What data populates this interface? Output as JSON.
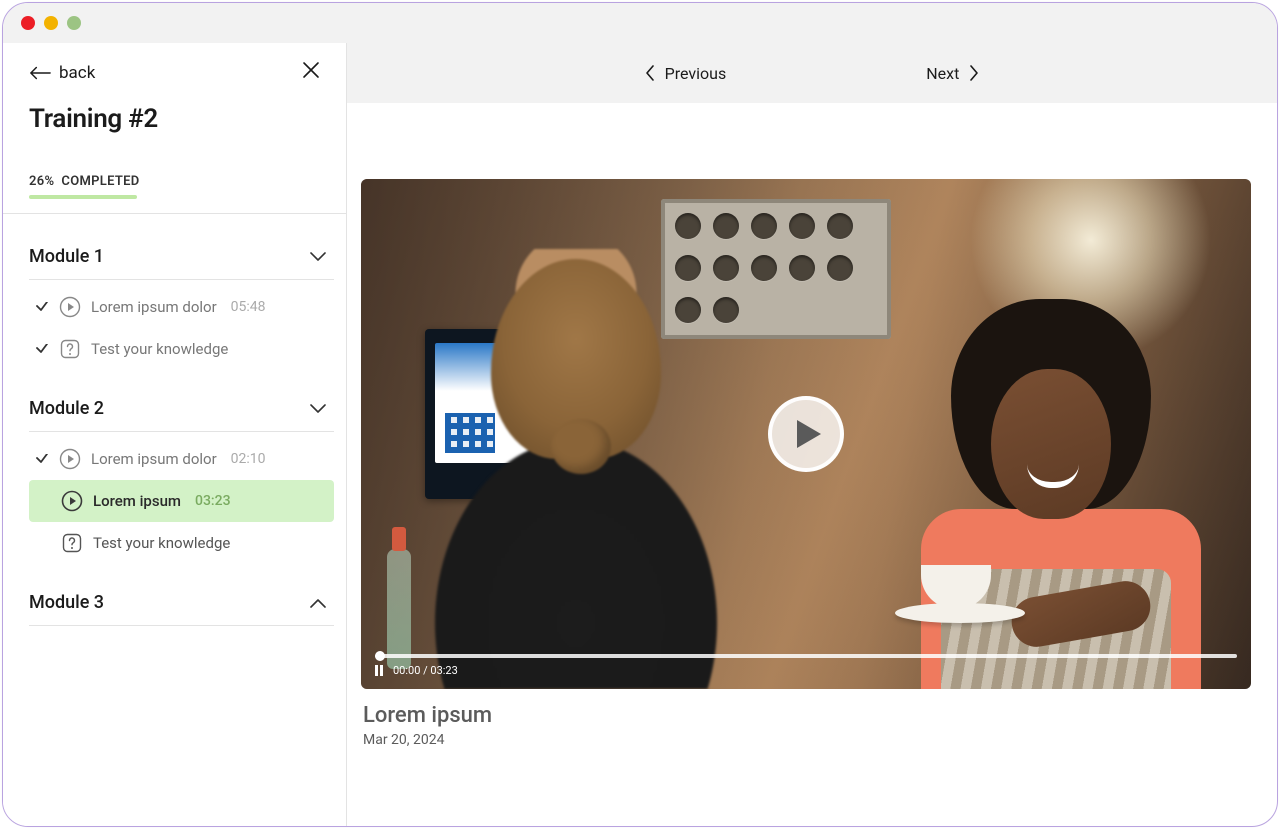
{
  "sidebar": {
    "back_label": "back",
    "title": "Training #2",
    "progress": {
      "percent": "26%",
      "word": "COMPLETED"
    }
  },
  "modules": [
    {
      "title": "Module 1",
      "expanded": true,
      "items": [
        {
          "type": "video",
          "label": "Lorem ipsum dolor",
          "duration": "05:48",
          "done": true
        },
        {
          "type": "quiz",
          "label": "Test your knowledge",
          "done": true
        }
      ]
    },
    {
      "title": "Module 2",
      "expanded": true,
      "items": [
        {
          "type": "video",
          "label": "Lorem ipsum dolor",
          "duration": "02:10",
          "done": true
        },
        {
          "type": "video",
          "label": "Lorem ipsum",
          "duration": "03:23",
          "current": true
        },
        {
          "type": "quiz",
          "label": "Test your knowledge"
        }
      ]
    },
    {
      "title": "Module 3",
      "expanded": false,
      "items": []
    }
  ],
  "topnav": {
    "prev": "Previous",
    "next": "Next"
  },
  "video": {
    "title": "Lorem ipsum",
    "date": "Mar 20, 2024",
    "time_current": "00:00",
    "time_total": "03:23",
    "time_display": "00:00 / 03:23"
  }
}
